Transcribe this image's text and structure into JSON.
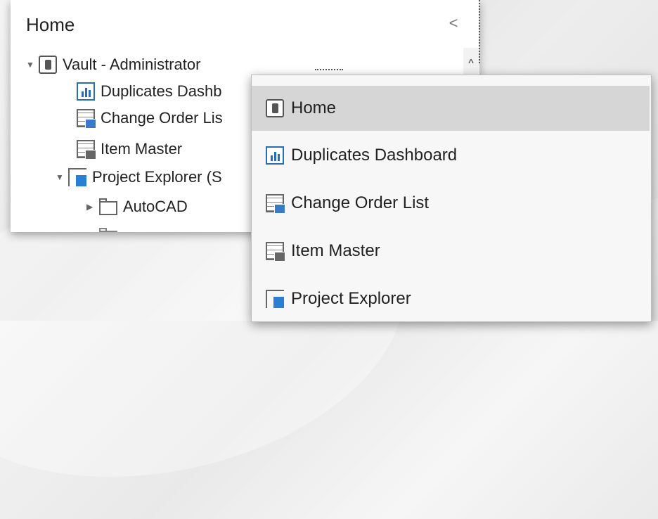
{
  "panel": {
    "title": "Home",
    "collapse_glyph": "<",
    "scroll_up_glyph": "^",
    "tree": [
      {
        "label": "Vault - Administrator",
        "icon": "vault-icon",
        "expanded": true
      },
      {
        "label": "Duplicates Dashb",
        "icon": "dashboard-icon"
      },
      {
        "label": "Change Order Lis",
        "icon": "change-order-list-icon"
      },
      {
        "label": "Item Master",
        "icon": "item-master-icon"
      },
      {
        "label": "Project Explorer (S",
        "icon": "project-explorer-icon",
        "expanded": true
      },
      {
        "label": "AutoCAD",
        "icon": "folder-icon",
        "expanded": false
      }
    ]
  },
  "dropdown": {
    "items": [
      {
        "label": "Home",
        "icon": "vault-icon",
        "selected": true
      },
      {
        "label": "Duplicates Dashboard",
        "icon": "dashboard-icon"
      },
      {
        "label": "Change Order List",
        "icon": "change-order-list-icon"
      },
      {
        "label": "Item Master",
        "icon": "item-master-icon"
      },
      {
        "label": "Project Explorer",
        "icon": "project-explorer-icon"
      }
    ]
  },
  "colors": {
    "accent_blue": "#2a6db5",
    "selected_bg": "#d6d6d6"
  }
}
